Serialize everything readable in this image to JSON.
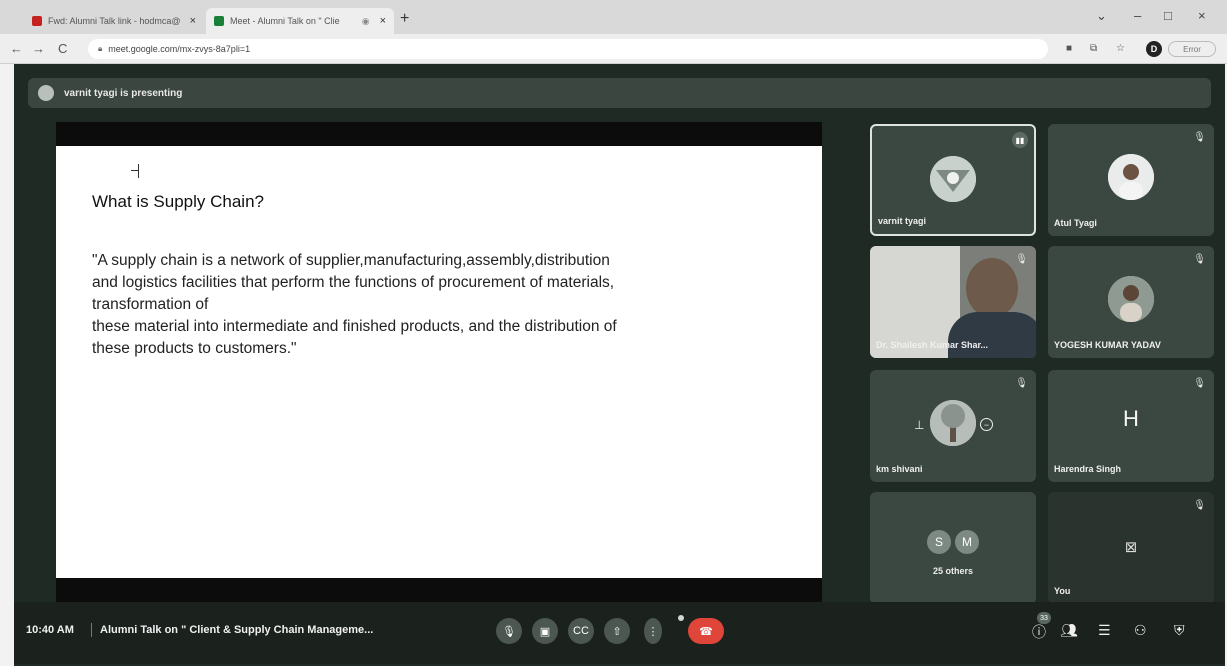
{
  "browser": {
    "tabs": [
      {
        "title": "Fwd: Alumni Talk link - hodmca@",
        "favicon_color": "#c5221f",
        "close": "×"
      },
      {
        "title": "Meet - Alumni Talk on \" Clie",
        "favicon_color": "#188038",
        "recording": "◉",
        "close": "×"
      }
    ],
    "new_tab": "+",
    "url": "meet.google.com/mx-zvys-8a7pli=1",
    "profile_initial": "D",
    "error_label": "Error",
    "window_controls": {
      "chevron": "⌄",
      "minimize": "–",
      "restore": "□",
      "close": "×"
    },
    "nav": {
      "back": "←",
      "forward": "→",
      "reload": "C"
    },
    "toolbar_icons": {
      "key": "■",
      "share": "⧉",
      "star": "☆"
    }
  },
  "meet": {
    "presenting_banner": "varnit tyagi is presenting",
    "slide": {
      "title": "What is Supply Chain?",
      "body_lines": {
        "l1": "\"A supply chain is a network of supplier,manufacturing,assembly,distribution",
        "l2": "and logistics facilities that perform the functions of procurement of materials,",
        "l3": "transformation of",
        "l4": "these material into intermediate and finished products, and the distribution of",
        "l5": "these products to customers.\""
      }
    },
    "participants": {
      "p1": {
        "name": "varnit tyagi",
        "status": "speaking"
      },
      "p2": {
        "name": "Atul Tyagi",
        "status": "muted"
      },
      "p3": {
        "name": "Dr. Shailesh Kumar Shar...",
        "status": "muted"
      },
      "p4": {
        "name": "YOGESH KUMAR YADAV",
        "status": "muted"
      },
      "p5": {
        "name": "km shivani",
        "status": "muted"
      },
      "p6": {
        "name": "Harendra Singh",
        "initial": "H",
        "status": "muted"
      },
      "p7": {
        "initials": [
          "S",
          "M"
        ],
        "label": "25 others"
      },
      "p8": {
        "name": "You",
        "status": "muted, camera off"
      }
    },
    "bottom_bar": {
      "time": "10:40 AM",
      "meeting_title": "Alumni Talk on \" Client & Supply Chain Manageme...",
      "participant_count": "33"
    }
  },
  "colors": {
    "end_call": "#e0453a",
    "meet_bg": "#1f2a24",
    "tile_bg": "#3b4842"
  }
}
